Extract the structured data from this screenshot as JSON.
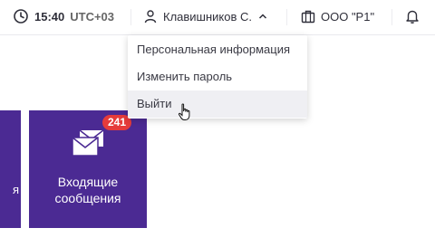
{
  "header": {
    "time": "15:40",
    "timezone": "UTC+03",
    "user_name": "Клавишников С.",
    "organization": "ООО \"Р1\""
  },
  "user_menu": {
    "items": [
      {
        "label": "Персональная информация"
      },
      {
        "label": "Изменить пароль"
      },
      {
        "label": "Выйти"
      }
    ]
  },
  "tiles": {
    "left_partial_text": "я",
    "inbox": {
      "caption_line1": "Входящие",
      "caption_line2": "сообщения",
      "badge_count": "241"
    }
  },
  "colors": {
    "tile_bg": "#4b2a93",
    "badge_bg": "#e53b3b"
  },
  "icons": [
    "clock-icon",
    "user-icon",
    "chevron-up-icon",
    "briefcase-icon",
    "bell-icon",
    "envelopes-icon",
    "hand-cursor-icon"
  ]
}
